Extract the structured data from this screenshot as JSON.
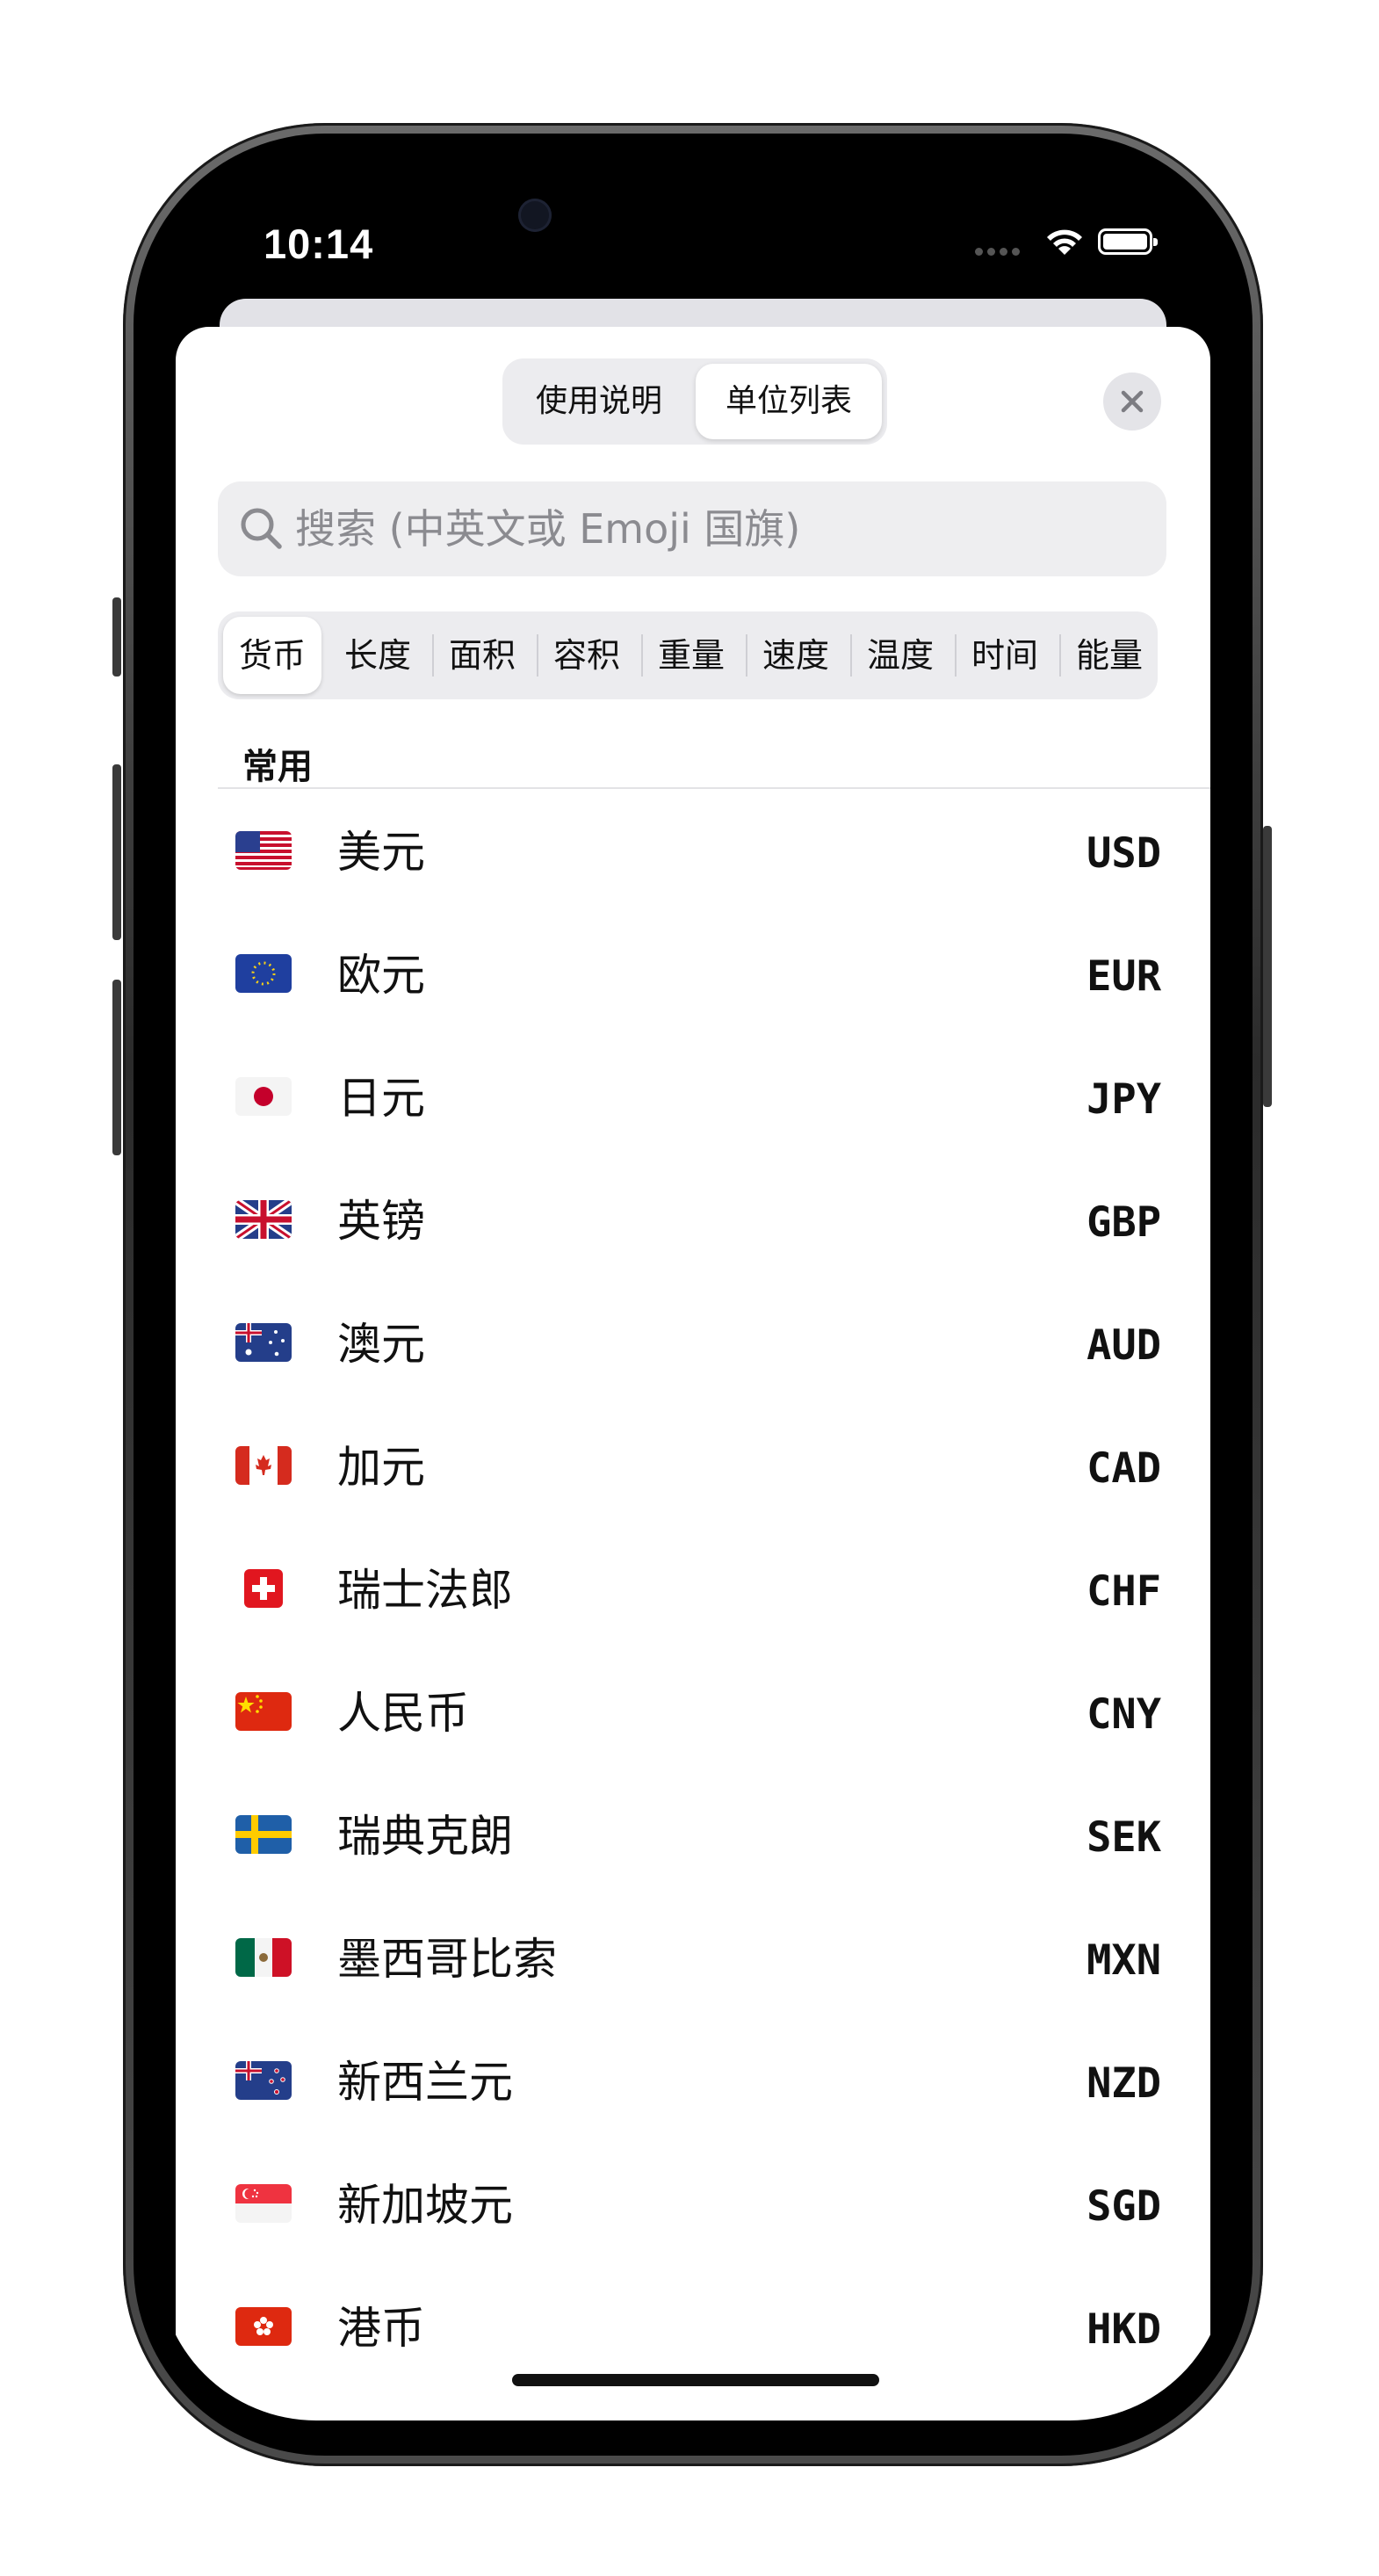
{
  "status_bar": {
    "time": "10:14"
  },
  "header": {
    "segments": [
      "使用说明",
      "单位列表"
    ],
    "selected_segment": "单位列表"
  },
  "search": {
    "placeholder": "搜索 (中英文或 Emoji 国旗)",
    "value": ""
  },
  "categories": {
    "items": [
      "货币",
      "长度",
      "面积",
      "容积",
      "重量",
      "速度",
      "温度",
      "时间",
      "能量"
    ],
    "selected": "货币"
  },
  "section": {
    "title": "常用"
  },
  "units": [
    {
      "name": "美元",
      "code": "USD",
      "flag_icon": "us-flag-icon"
    },
    {
      "name": "欧元",
      "code": "EUR",
      "flag_icon": "eu-flag-icon"
    },
    {
      "name": "日元",
      "code": "JPY",
      "flag_icon": "jp-flag-icon"
    },
    {
      "name": "英镑",
      "code": "GBP",
      "flag_icon": "gb-flag-icon"
    },
    {
      "name": "澳元",
      "code": "AUD",
      "flag_icon": "au-flag-icon"
    },
    {
      "name": "加元",
      "code": "CAD",
      "flag_icon": "ca-flag-icon"
    },
    {
      "name": "瑞士法郎",
      "code": "CHF",
      "flag_icon": "ch-flag-icon"
    },
    {
      "name": "人民币",
      "code": "CNY",
      "flag_icon": "cn-flag-icon"
    },
    {
      "name": "瑞典克朗",
      "code": "SEK",
      "flag_icon": "se-flag-icon"
    },
    {
      "name": "墨西哥比索",
      "code": "MXN",
      "flag_icon": "mx-flag-icon"
    },
    {
      "name": "新西兰元",
      "code": "NZD",
      "flag_icon": "nz-flag-icon"
    },
    {
      "name": "新加坡元",
      "code": "SGD",
      "flag_icon": "sg-flag-icon"
    },
    {
      "name": "港币",
      "code": "HKD",
      "flag_icon": "hk-flag-icon"
    }
  ]
}
